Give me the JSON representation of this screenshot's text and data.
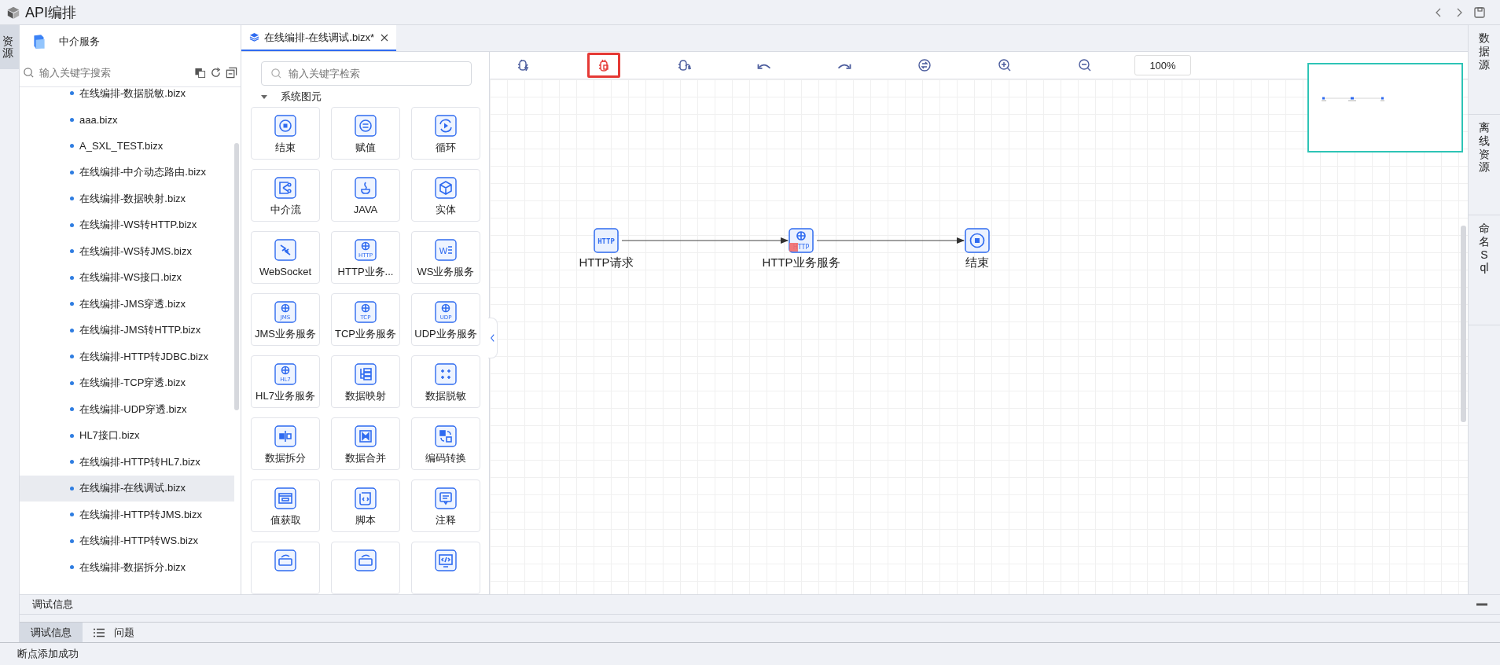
{
  "window": {
    "title": "API编排"
  },
  "left_strip": [
    {
      "label": "资源",
      "selected": true
    }
  ],
  "tree": {
    "title": "中介服务",
    "search": {
      "placeholder": "输入关键字搜索"
    },
    "items": [
      {
        "label": "在线编排-数据脱敏.bizx",
        "selected": false
      },
      {
        "label": "aaa.bizx",
        "selected": false
      },
      {
        "label": "A_SXL_TEST.bizx",
        "selected": false
      },
      {
        "label": "在线编排-中介动态路由.bizx",
        "selected": false
      },
      {
        "label": "在线编排-数据映射.bizx",
        "selected": false
      },
      {
        "label": "在线编排-WS转HTTP.bizx",
        "selected": false
      },
      {
        "label": "在线编排-WS转JMS.bizx",
        "selected": false
      },
      {
        "label": "在线编排-WS接口.bizx",
        "selected": false
      },
      {
        "label": "在线编排-JMS穿透.bizx",
        "selected": false
      },
      {
        "label": "在线编排-JMS转HTTP.bizx",
        "selected": false
      },
      {
        "label": "在线编排-HTTP转JDBC.bizx",
        "selected": false
      },
      {
        "label": "在线编排-TCP穿透.bizx",
        "selected": false
      },
      {
        "label": "在线编排-UDP穿透.bizx",
        "selected": false
      },
      {
        "label": "HL7接口.bizx",
        "selected": false
      },
      {
        "label": "在线编排-HTTP转HL7.bizx",
        "selected": false
      },
      {
        "label": "在线编排-在线调试.bizx",
        "selected": true
      },
      {
        "label": "在线编排-HTTP转JMS.bizx",
        "selected": false
      },
      {
        "label": "在线编排-HTTP转WS.bizx",
        "selected": false
      },
      {
        "label": "在线编排-数据拆分.bizx",
        "selected": false
      }
    ]
  },
  "tabs": [
    {
      "label": "在线编排-在线调试.bizx*",
      "selected": true
    }
  ],
  "palette": {
    "search": {
      "placeholder": "输入关键字检索"
    },
    "group": {
      "label": "系统图元",
      "expanded": true
    },
    "rows": [
      {
        "tiles": [
          {
            "kind": "end",
            "label": "结束"
          },
          {
            "kind": "assign",
            "label": "赋值"
          },
          {
            "kind": "loop",
            "label": "循环"
          }
        ]
      },
      {
        "tiles": [
          {
            "kind": "flow",
            "label": "中介流"
          },
          {
            "kind": "java",
            "label": "JAVA"
          },
          {
            "kind": "entity",
            "label": "实体"
          }
        ]
      },
      {
        "tiles": [
          {
            "kind": "websocket",
            "label": "WebSocket"
          },
          {
            "kind": "globe",
            "label": "HTTP业务...",
            "icon_text": "HTTP"
          },
          {
            "kind": "ws",
            "label": "WS业务服务",
            "icon_text": "W"
          }
        ]
      },
      {
        "tiles": [
          {
            "kind": "globe",
            "label": "JMS业务服务",
            "icon_text": "JMS"
          },
          {
            "kind": "globe",
            "label": "TCP业务服务",
            "icon_text": "TCP"
          },
          {
            "kind": "globe",
            "label": "UDP业务服务",
            "icon_text": "UDP"
          }
        ]
      },
      {
        "tiles": [
          {
            "kind": "globe",
            "label": "HL7业务服务",
            "icon_text": "HL7"
          },
          {
            "kind": "mapping",
            "label": "数据映射"
          },
          {
            "kind": "mask",
            "label": "数据脱敏"
          }
        ]
      },
      {
        "tiles": [
          {
            "kind": "split",
            "label": "数据拆分"
          },
          {
            "kind": "merge",
            "label": "数据合并"
          },
          {
            "kind": "encode",
            "label": "编码转换"
          }
        ]
      },
      {
        "tiles": [
          {
            "kind": "value",
            "label": "值获取"
          },
          {
            "kind": "script",
            "label": "脚本"
          },
          {
            "kind": "note",
            "label": "注释"
          }
        ]
      },
      {
        "tiles": [
          {
            "kind": "convert"
          },
          {
            "kind": "convert"
          },
          {
            "kind": "code"
          }
        ]
      }
    ]
  },
  "toolbar": [
    {
      "kind": "debug-run",
      "selected": false
    },
    {
      "kind": "breakpoint",
      "selected": true
    },
    {
      "kind": "debug-step",
      "selected": false
    },
    {
      "kind": "undo",
      "selected": false
    },
    {
      "kind": "redo",
      "selected": false
    },
    {
      "kind": "swap",
      "selected": false
    },
    {
      "kind": "zoom-in",
      "selected": false
    },
    {
      "kind": "zoom-out",
      "selected": false
    }
  ],
  "zoom": "100%",
  "nodes": [
    {
      "kind": "http",
      "icon_text": "HTTP",
      "label": "HTTP请求",
      "breakpoint": false
    },
    {
      "kind": "globe",
      "icon_text": "HTTP",
      "label": "HTTP业务服务",
      "breakpoint": true
    },
    {
      "kind": "end",
      "label": "结束",
      "breakpoint": false
    }
  ],
  "right_strip": [
    {
      "label": "数据源"
    },
    {
      "label": "离线资源"
    },
    {
      "label": "命名Sql"
    }
  ],
  "debug_panel": {
    "title": "调试信息"
  },
  "bottom_tabs": [
    {
      "label": "调试信息",
      "kind": "text",
      "selected": true
    },
    {
      "label": "问题",
      "kind": "list",
      "selected": false
    }
  ],
  "status_bar": "断点添加成功"
}
